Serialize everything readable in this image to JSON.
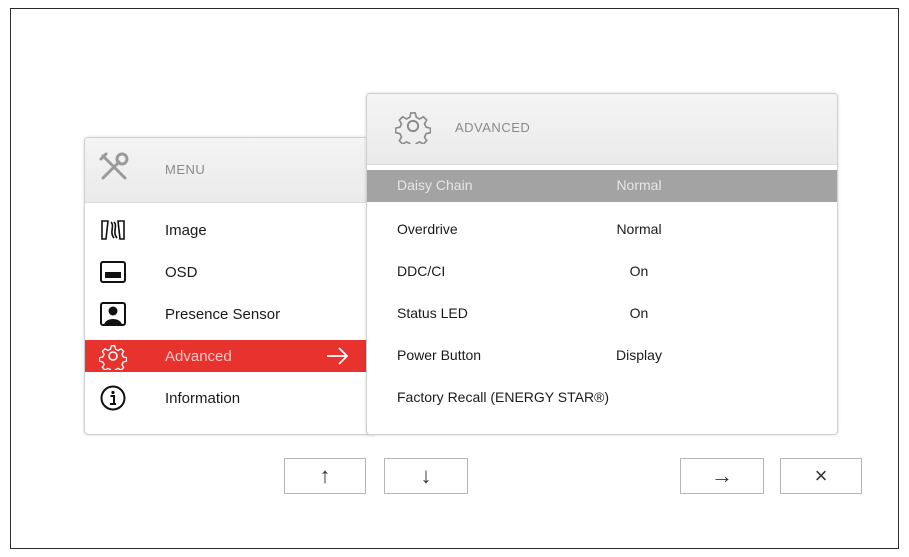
{
  "menu": {
    "title": "MENU",
    "header_icon": "tools-icon",
    "items": [
      {
        "label": "Image",
        "icon": "image-icon"
      },
      {
        "label": "OSD",
        "icon": "osd-icon"
      },
      {
        "label": "Presence Sensor",
        "icon": "presence-sensor-icon"
      },
      {
        "label": "Advanced",
        "icon": "gear-icon",
        "active": true
      },
      {
        "label": "Information",
        "icon": "info-icon"
      }
    ]
  },
  "advanced": {
    "title": "ADVANCED",
    "header_icon": "gear-icon",
    "rows": [
      {
        "label": "Daisy Chain",
        "value": "Normal",
        "active": true
      },
      {
        "label": "Overdrive",
        "value": "Normal"
      },
      {
        "label": "DDC/CI",
        "value": "On"
      },
      {
        "label": "Status LED",
        "value": "On"
      },
      {
        "label": "Power Button",
        "value": "Display"
      },
      {
        "label": "Factory Recall (ENERGY STAR®)",
        "value": ""
      }
    ]
  },
  "buttons": {
    "up": "↑",
    "down": "↓",
    "enter": "→",
    "exit": "×"
  },
  "colors": {
    "accent": "#e8322e",
    "selected_row": "#a3a3a3"
  }
}
